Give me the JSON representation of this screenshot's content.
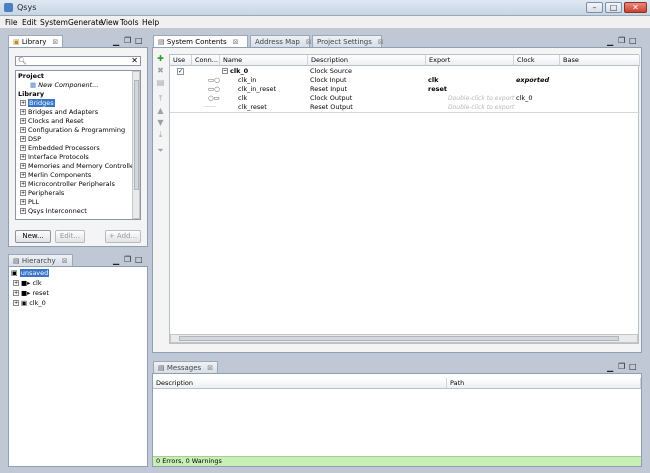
{
  "window": {
    "title": "Qsys"
  },
  "menu": [
    "File",
    "Edit",
    "System",
    "Generate",
    "View",
    "Tools",
    "Help"
  ],
  "library": {
    "tab": "Library",
    "search_placeholder": "",
    "project_header": "Project",
    "new_component": "New Component...",
    "library_header": "Library",
    "items": [
      "Bridges",
      "Bridges and Adapters",
      "Clocks and Reset",
      "Configuration & Programming",
      "DSP",
      "Embedded Processors",
      "Interface Protocols",
      "Memories and Memory Controllers",
      "Merlin Components",
      "Microcontroller Peripherals",
      "Peripherals",
      "PLL",
      "Qsys Interconnect"
    ],
    "buttons": {
      "new": "New...",
      "edit": "Edit...",
      "add": "+ Add..."
    }
  },
  "hierarchy": {
    "tab": "Hierarchy",
    "root": "unsaved",
    "items": [
      "clk",
      "reset",
      "clk_0"
    ]
  },
  "center_tabs": [
    "System Contents",
    "Address Map",
    "Project Settings"
  ],
  "system_table": {
    "columns": [
      "Use",
      "Conn...",
      "Name",
      "Description",
      "Export",
      "Clock",
      "Base"
    ],
    "rows": [
      {
        "name": "clk_0",
        "description": "Clock Source",
        "export": "",
        "clock": ""
      },
      {
        "name": "clk_in",
        "description": "Clock Input",
        "export": "clk",
        "clock": "exported"
      },
      {
        "name": "clk_in_reset",
        "description": "Reset Input",
        "export": "reset",
        "clock": ""
      },
      {
        "name": "clk",
        "description": "Clock Output",
        "export": "Double-click to export",
        "clock": "clk_0"
      },
      {
        "name": "clk_reset",
        "description": "Reset Output",
        "export": "Double-click to export",
        "clock": ""
      }
    ]
  },
  "messages": {
    "tab": "Messages",
    "columns": [
      "Description",
      "Path"
    ],
    "status": "0 Errors, 0 Warnings"
  },
  "colors": {
    "status_bar": "#c8f0b4",
    "selection": "#3874c8"
  }
}
